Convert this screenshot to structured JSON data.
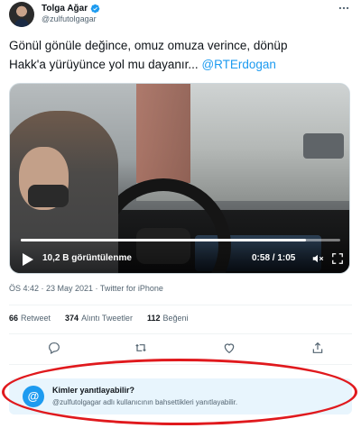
{
  "author": {
    "display_name": "Tolga Ağar",
    "handle": "@zulfutolgagar",
    "verified": true
  },
  "tweet": {
    "text_line1": "Gönül gönüle değince, omuz omuza verince, dönüp",
    "text_line2": "Hakk'a yürüyünce yol mu dayanır... ",
    "mention": "@RTErdogan"
  },
  "video": {
    "views": "10,2 B görüntülenme",
    "timer": "0:58 / 1:05",
    "progress_fraction": 0.892
  },
  "meta": {
    "timestamp": "ÖS 4:42 · 23 May 2021 · Twitter for iPhone"
  },
  "stats": {
    "retweets_count": "66",
    "retweets_label": "Retweet",
    "quotes_count": "374",
    "quotes_label": "Alıntı Tweetler",
    "likes_count": "112",
    "likes_label": "Beğeni"
  },
  "reply_restriction": {
    "title": "Kimler yanıtlayabilir?",
    "description": "@zulfutolgagar adlı kullanıcının bahsettikleri yanıtlayabilir.",
    "icon": "@"
  },
  "colors": {
    "accent": "#1d9bf0",
    "highlight": "#e0191d",
    "muted_text": "#536471",
    "reply_bg": "#e8f5fd"
  }
}
